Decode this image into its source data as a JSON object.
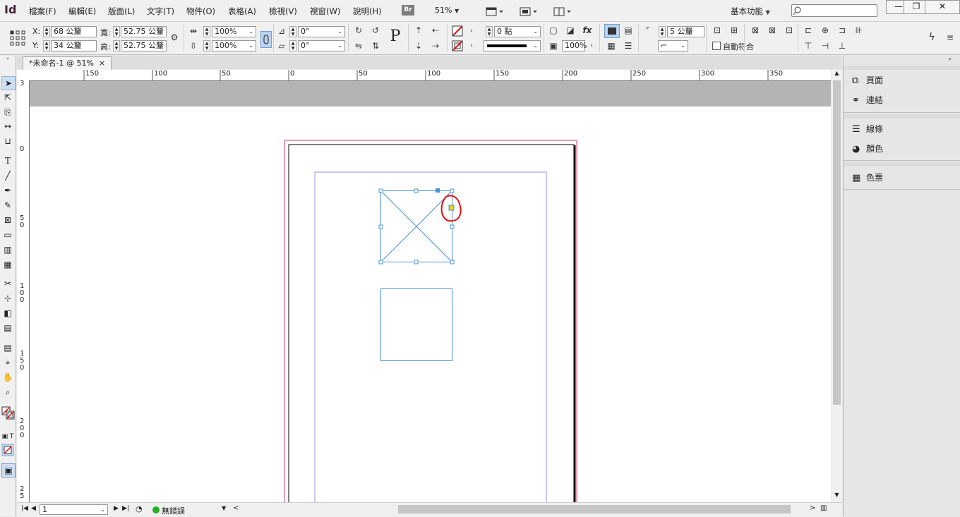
{
  "app": {
    "logo": "Id",
    "zoom": "51%",
    "workspace": "基本功能",
    "bridge": "Br"
  },
  "menu": [
    "檔案(F)",
    "編輯(E)",
    "版面(L)",
    "文字(T)",
    "物件(O)",
    "表格(A)",
    "檢視(V)",
    "視窗(W)",
    "說明(H)"
  ],
  "control": {
    "x_label": "X:",
    "x": "68 公釐",
    "y_label": "Y:",
    "y": "34 公釐",
    "w_label": "寬:",
    "w": "52.75 公釐",
    "h_label": "高:",
    "h": "52.75 公釐",
    "scale_x": "100%",
    "scale_y": "100%",
    "rotate": "0°",
    "shear": "0°",
    "stroke_weight": "0 點",
    "opacity": "100%",
    "corner": "5 公釐",
    "autofit": "自動符合"
  },
  "document": {
    "tab_title": "*未命名-1 @ 51%",
    "close": "×"
  },
  "hruler_ticks": [
    "150",
    "100",
    "50",
    "0",
    "50",
    "100",
    "150",
    "200",
    "250",
    "300",
    "350"
  ],
  "vruler_ticks": [
    "3",
    "0",
    "5\n0",
    "1\n0\n0",
    "1\n5\n0",
    "2\n0\n0",
    "2\n5"
  ],
  "status": {
    "page": "1",
    "errors": "無錯誤"
  },
  "panels": [
    {
      "name": "頁面",
      "icon": "pages-icon"
    },
    {
      "name": "連結",
      "icon": "links-icon"
    },
    {
      "name": "線條",
      "icon": "stroke-icon"
    },
    {
      "name": "顏色",
      "icon": "color-icon"
    },
    {
      "name": "色票",
      "icon": "swatches-icon"
    }
  ],
  "colors": {
    "margin": "#d0396e",
    "guide": "#a08ae0",
    "frame": "#4a90d9",
    "highlight": "#e01010",
    "handle_yellow": "#f2d400"
  }
}
